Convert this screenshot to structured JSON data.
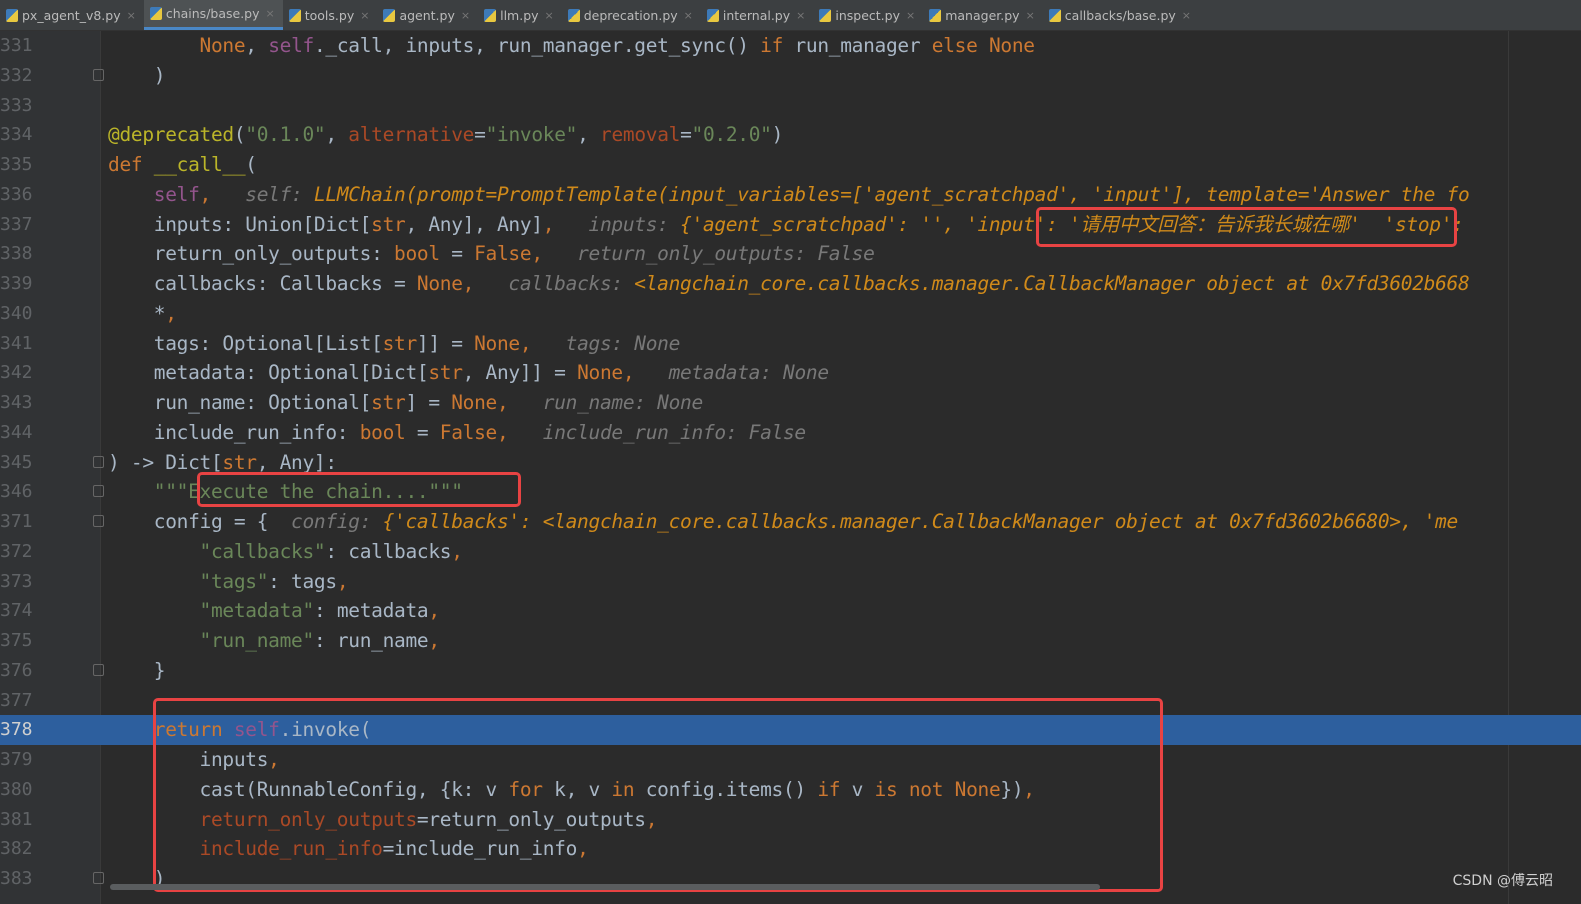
{
  "tabs": [
    {
      "label": "px_agent_v8.py",
      "active": false
    },
    {
      "label": "chains/base.py",
      "active": true
    },
    {
      "label": "tools.py",
      "active": false
    },
    {
      "label": "agent.py",
      "active": false
    },
    {
      "label": "llm.py",
      "active": false
    },
    {
      "label": "deprecation.py",
      "active": false
    },
    {
      "label": "internal.py",
      "active": false
    },
    {
      "label": "inspect.py",
      "active": false
    },
    {
      "label": "manager.py",
      "active": false
    },
    {
      "label": "callbacks/base.py",
      "active": false
    }
  ],
  "close_glyph": "×",
  "lines": [
    {
      "n": "331",
      "t": [
        [
          "d",
          "        "
        ],
        [
          "k",
          "None"
        ],
        [
          "d",
          ", "
        ],
        [
          "sf",
          "self"
        ],
        [
          "d",
          "._call, inputs, run_manager.get_sync() "
        ],
        [
          "k",
          "if"
        ],
        [
          "d",
          " run_manager "
        ],
        [
          "k",
          "else"
        ],
        [
          "d",
          " "
        ],
        [
          "k",
          "None"
        ]
      ]
    },
    {
      "n": "332",
      "fold": true,
      "t": [
        [
          "d",
          "    )"
        ]
      ]
    },
    {
      "n": "333",
      "t": []
    },
    {
      "n": "334",
      "t": [
        [
          "dec",
          "@deprecated"
        ],
        [
          "d",
          "("
        ],
        [
          "s",
          "\"0.1.0\""
        ],
        [
          "d",
          ", "
        ],
        [
          "p",
          "alternative"
        ],
        [
          "d",
          "="
        ],
        [
          "s",
          "\"invoke\""
        ],
        [
          "d",
          ", "
        ],
        [
          "p",
          "removal"
        ],
        [
          "d",
          "="
        ],
        [
          "s",
          "\"0.2.0\""
        ],
        [
          "d",
          ")"
        ]
      ]
    },
    {
      "n": "335",
      "t": [
        [
          "k",
          "def "
        ],
        [
          "dec",
          "__call__"
        ],
        [
          "d",
          "("
        ]
      ]
    },
    {
      "n": "336",
      "t": [
        [
          "d",
          "    "
        ],
        [
          "sf",
          "self"
        ],
        [
          "k",
          ", "
        ],
        [
          "h",
          "  self: "
        ],
        [
          "hv",
          "LLMChain(prompt=PromptTemplate(input_variables=['agent_scratchpad', 'input'], template='Answer the fo"
        ]
      ]
    },
    {
      "n": "337",
      "t": [
        [
          "d",
          "    inputs: Union[Dict["
        ],
        [
          "k",
          "str"
        ],
        [
          "d",
          ", Any], Any]"
        ],
        [
          "k",
          ", "
        ],
        [
          "h",
          "  inputs: "
        ],
        [
          "hv",
          "{'agent_scratchpad': '', 'input': '请用中文回答：告诉我长城在哪'  'stop': "
        ]
      ]
    },
    {
      "n": "338",
      "t": [
        [
          "d",
          "    return_only_outputs: "
        ],
        [
          "k",
          "bool"
        ],
        [
          "d",
          " = "
        ],
        [
          "k",
          "False"
        ],
        [
          "k",
          ", "
        ],
        [
          "h",
          "  return_only_outputs: False"
        ]
      ]
    },
    {
      "n": "339",
      "t": [
        [
          "d",
          "    callbacks: Callbacks = "
        ],
        [
          "k",
          "None"
        ],
        [
          "k",
          ", "
        ],
        [
          "h",
          "  callbacks: "
        ],
        [
          "hv",
          "<langchain_core.callbacks.manager.CallbackManager object at 0x7fd3602b668"
        ]
      ]
    },
    {
      "n": "340",
      "t": [
        [
          "d",
          "    *"
        ],
        [
          "k",
          ","
        ]
      ]
    },
    {
      "n": "341",
      "t": [
        [
          "d",
          "    tags: Optional[List["
        ],
        [
          "k",
          "str"
        ],
        [
          "d",
          "]] = "
        ],
        [
          "k",
          "None"
        ],
        [
          "k",
          ", "
        ],
        [
          "h",
          "  tags: None"
        ]
      ]
    },
    {
      "n": "342",
      "t": [
        [
          "d",
          "    metadata: Optional[Dict["
        ],
        [
          "k",
          "str"
        ],
        [
          "d",
          ", Any]] = "
        ],
        [
          "k",
          "None"
        ],
        [
          "k",
          ", "
        ],
        [
          "h",
          "  metadata: None"
        ]
      ]
    },
    {
      "n": "343",
      "t": [
        [
          "d",
          "    run_name: Optional["
        ],
        [
          "k",
          "str"
        ],
        [
          "d",
          "] = "
        ],
        [
          "k",
          "None"
        ],
        [
          "k",
          ", "
        ],
        [
          "h",
          "  run_name: None"
        ]
      ]
    },
    {
      "n": "344",
      "t": [
        [
          "d",
          "    include_run_info: "
        ],
        [
          "k",
          "bool"
        ],
        [
          "d",
          " = "
        ],
        [
          "k",
          "False"
        ],
        [
          "k",
          ", "
        ],
        [
          "h",
          "  include_run_info: False"
        ]
      ]
    },
    {
      "n": "345",
      "fold": true,
      "t": [
        [
          "d",
          ") -> Dict["
        ],
        [
          "k",
          "str"
        ],
        [
          "d",
          ", Any]:"
        ]
      ]
    },
    {
      "n": "346",
      "fold": true,
      "t": [
        [
          "d",
          "    "
        ],
        [
          "s",
          "\"\"\"Execute the chain....\"\"\""
        ]
      ]
    },
    {
      "n": "371",
      "fold": true,
      "t": [
        [
          "d",
          "    config = {"
        ],
        [
          "h",
          "  config: "
        ],
        [
          "hv",
          "{'callbacks': <langchain_core.callbacks.manager.CallbackManager object at 0x7fd3602b6680>, 'me"
        ]
      ]
    },
    {
      "n": "372",
      "t": [
        [
          "d",
          "        "
        ],
        [
          "s",
          "\"callbacks\""
        ],
        [
          "d",
          ": callbacks"
        ],
        [
          "k",
          ","
        ]
      ]
    },
    {
      "n": "373",
      "t": [
        [
          "d",
          "        "
        ],
        [
          "s",
          "\"tags\""
        ],
        [
          "d",
          ": tags"
        ],
        [
          "k",
          ","
        ]
      ]
    },
    {
      "n": "374",
      "t": [
        [
          "d",
          "        "
        ],
        [
          "s",
          "\"metadata\""
        ],
        [
          "d",
          ": metadata"
        ],
        [
          "k",
          ","
        ]
      ]
    },
    {
      "n": "375",
      "t": [
        [
          "d",
          "        "
        ],
        [
          "s",
          "\"run_name\""
        ],
        [
          "d",
          ": run_name"
        ],
        [
          "k",
          ","
        ]
      ]
    },
    {
      "n": "376",
      "fold": true,
      "t": [
        [
          "d",
          "    }"
        ]
      ]
    },
    {
      "n": "377",
      "t": []
    },
    {
      "n": "378",
      "hl": true,
      "t": [
        [
          "d",
          "    "
        ],
        [
          "k",
          "return "
        ],
        [
          "sf",
          "self"
        ],
        [
          "d",
          ".invoke("
        ]
      ]
    },
    {
      "n": "379",
      "t": [
        [
          "d",
          "        inputs"
        ],
        [
          "k",
          ","
        ]
      ]
    },
    {
      "n": "380",
      "t": [
        [
          "d",
          "        cast(RunnableConfig, {k: v "
        ],
        [
          "k",
          "for"
        ],
        [
          "d",
          " k, v "
        ],
        [
          "k",
          "in"
        ],
        [
          "d",
          " config.items() "
        ],
        [
          "k",
          "if"
        ],
        [
          "d",
          " v "
        ],
        [
          "k",
          "is not"
        ],
        [
          "d",
          " "
        ],
        [
          "k",
          "None"
        ],
        [
          "d",
          "})"
        ],
        [
          "k",
          ","
        ]
      ]
    },
    {
      "n": "381",
      "t": [
        [
          "d",
          "        "
        ],
        [
          "p",
          "return_only_outputs"
        ],
        [
          "d",
          "=return_only_outputs"
        ],
        [
          "k",
          ","
        ]
      ]
    },
    {
      "n": "382",
      "t": [
        [
          "d",
          "        "
        ],
        [
          "p",
          "include_run_info"
        ],
        [
          "d",
          "=include_run_info"
        ],
        [
          "k",
          ","
        ]
      ]
    },
    {
      "n": "383",
      "fold": true,
      "t": [
        [
          "d",
          "    )"
        ]
      ]
    }
  ],
  "watermark": "CSDN @傅云昭"
}
